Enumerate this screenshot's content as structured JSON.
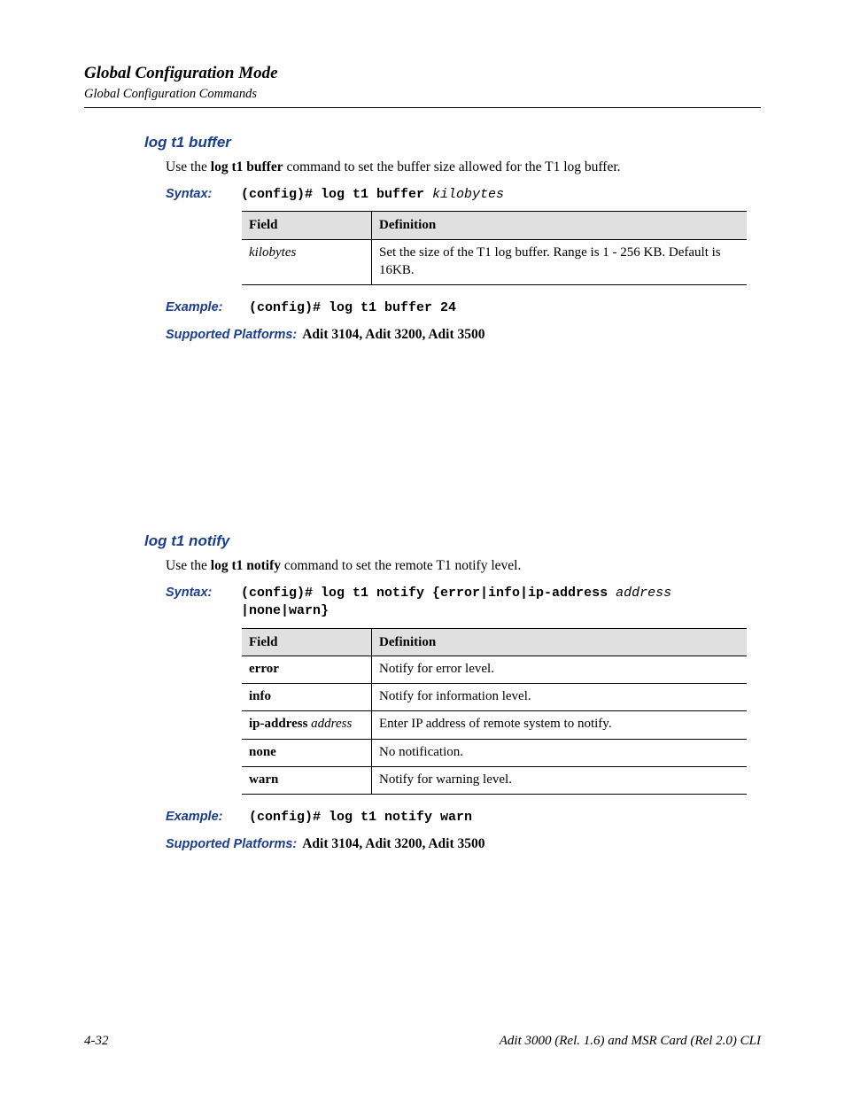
{
  "header": {
    "title": "Global Configuration Mode",
    "subtitle": "Global Configuration Commands"
  },
  "sections": [
    {
      "title": "log t1 buffer",
      "body_pre": "Use the ",
      "body_bold": "log t1 buffer",
      "body_post": " command to set the buffer size allowed for the T1 log buffer.",
      "syntax_label": "Syntax:",
      "syntax_prompt": "(config)# log t1 buffer ",
      "syntax_args": "kilobytes",
      "table": {
        "headers": [
          "Field",
          "Definition"
        ],
        "rows": [
          {
            "field_italic": "kilobytes",
            "definition": "Set the size of  the T1 log buffer. Range is 1 - 256 KB.   Default is 16KB."
          }
        ]
      },
      "example_label": "Example:",
      "example_code": "(config)# log t1 buffer 24",
      "platforms_label": "Supported Platforms:",
      "platforms_value": "Adit 3104, Adit 3200, Adit 3500"
    },
    {
      "title": "log t1 notify",
      "body_pre": "Use the ",
      "body_bold": "log t1 notify",
      "body_post": " command to set the remote T1 notify level.",
      "syntax_label": "Syntax:",
      "syntax_line1_bold": "(config)# log t1 notify {error|info|ip-address ",
      "syntax_line1_italic": "address",
      "syntax_line2_bold": "|none|warn}",
      "table": {
        "headers": [
          "Field",
          "Definition"
        ],
        "rows": [
          {
            "field_bold": "error",
            "definition": "Notify for error level."
          },
          {
            "field_bold": "info",
            "definition": "Notify for information level."
          },
          {
            "field_bold": "ip-address ",
            "field_italic": "address",
            "definition": "Enter IP address of remote system to notify."
          },
          {
            "field_bold": "none",
            "definition": "No notification."
          },
          {
            "field_bold": "warn",
            "definition": "Notify for warning level."
          }
        ]
      },
      "example_label": "Example:",
      "example_code": "(config)# log t1 notify warn",
      "platforms_label": "Supported Platforms:",
      "platforms_value": "Adit 3104, Adit 3200, Adit 3500"
    }
  ],
  "footer": {
    "page": "4-32",
    "doc": "Adit 3000 (Rel. 1.6) and MSR Card (Rel 2.0) CLI"
  }
}
